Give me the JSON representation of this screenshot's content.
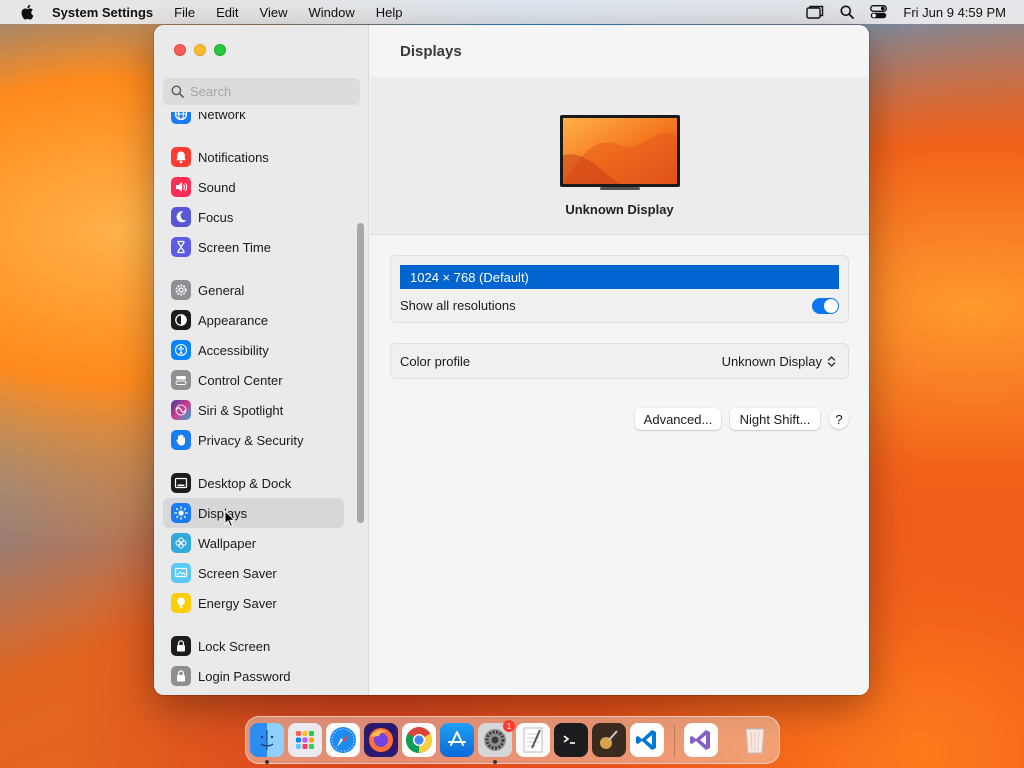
{
  "menubar": {
    "app_name": "System Settings",
    "items": [
      "File",
      "Edit",
      "View",
      "Window",
      "Help"
    ],
    "clock": "Fri Jun 9  4:59 PM"
  },
  "sidebar": {
    "search_placeholder": "Search",
    "items": [
      {
        "label": "Network",
        "icon": "network-icon",
        "color": "#1a7cf5"
      },
      {
        "label": "Notifications",
        "icon": "notifications-icon",
        "color": "#ff3b30"
      },
      {
        "label": "Sound",
        "icon": "sound-icon",
        "color": "#ff2d55"
      },
      {
        "label": "Focus",
        "icon": "focus-icon",
        "color": "#5856d6"
      },
      {
        "label": "Screen Time",
        "icon": "screen-time-icon",
        "color": "#5e5ce6"
      },
      {
        "label": "General",
        "icon": "general-icon",
        "color": "#8e8e93"
      },
      {
        "label": "Appearance",
        "icon": "appearance-icon",
        "color": "#1c1c1e"
      },
      {
        "label": "Accessibility",
        "icon": "accessibility-icon",
        "color": "#0a84ff"
      },
      {
        "label": "Control Center",
        "icon": "control-center-icon",
        "color": "#8e8e93"
      },
      {
        "label": "Siri & Spotlight",
        "icon": "siri-icon",
        "color": "#bf5af2"
      },
      {
        "label": "Privacy & Security",
        "icon": "privacy-icon",
        "color": "#1a7cf5"
      },
      {
        "label": "Desktop & Dock",
        "icon": "desktop-dock-icon",
        "color": "#1c1c1e"
      },
      {
        "label": "Displays",
        "icon": "displays-icon",
        "color": "#1a7cf5"
      },
      {
        "label": "Wallpaper",
        "icon": "wallpaper-icon",
        "color": "#34aadc"
      },
      {
        "label": "Screen Saver",
        "icon": "screen-saver-icon",
        "color": "#5ac8fa"
      },
      {
        "label": "Energy Saver",
        "icon": "energy-saver-icon",
        "color": "#ffcc00"
      },
      {
        "label": "Lock Screen",
        "icon": "lock-screen-icon",
        "color": "#1c1c1e"
      },
      {
        "label": "Login Password",
        "icon": "login-password-icon",
        "color": "#8e8e93"
      }
    ]
  },
  "content": {
    "title": "Displays",
    "display_name": "Unknown Display",
    "resolution": "1024 × 768 (Default)",
    "show_all_label": "Show all resolutions",
    "color_profile_label": "Color profile",
    "color_profile_value": "Unknown Display",
    "advanced_button": "Advanced...",
    "night_shift_button": "Night Shift...",
    "help_button": "?"
  },
  "dock": {
    "badge_count": "1"
  }
}
